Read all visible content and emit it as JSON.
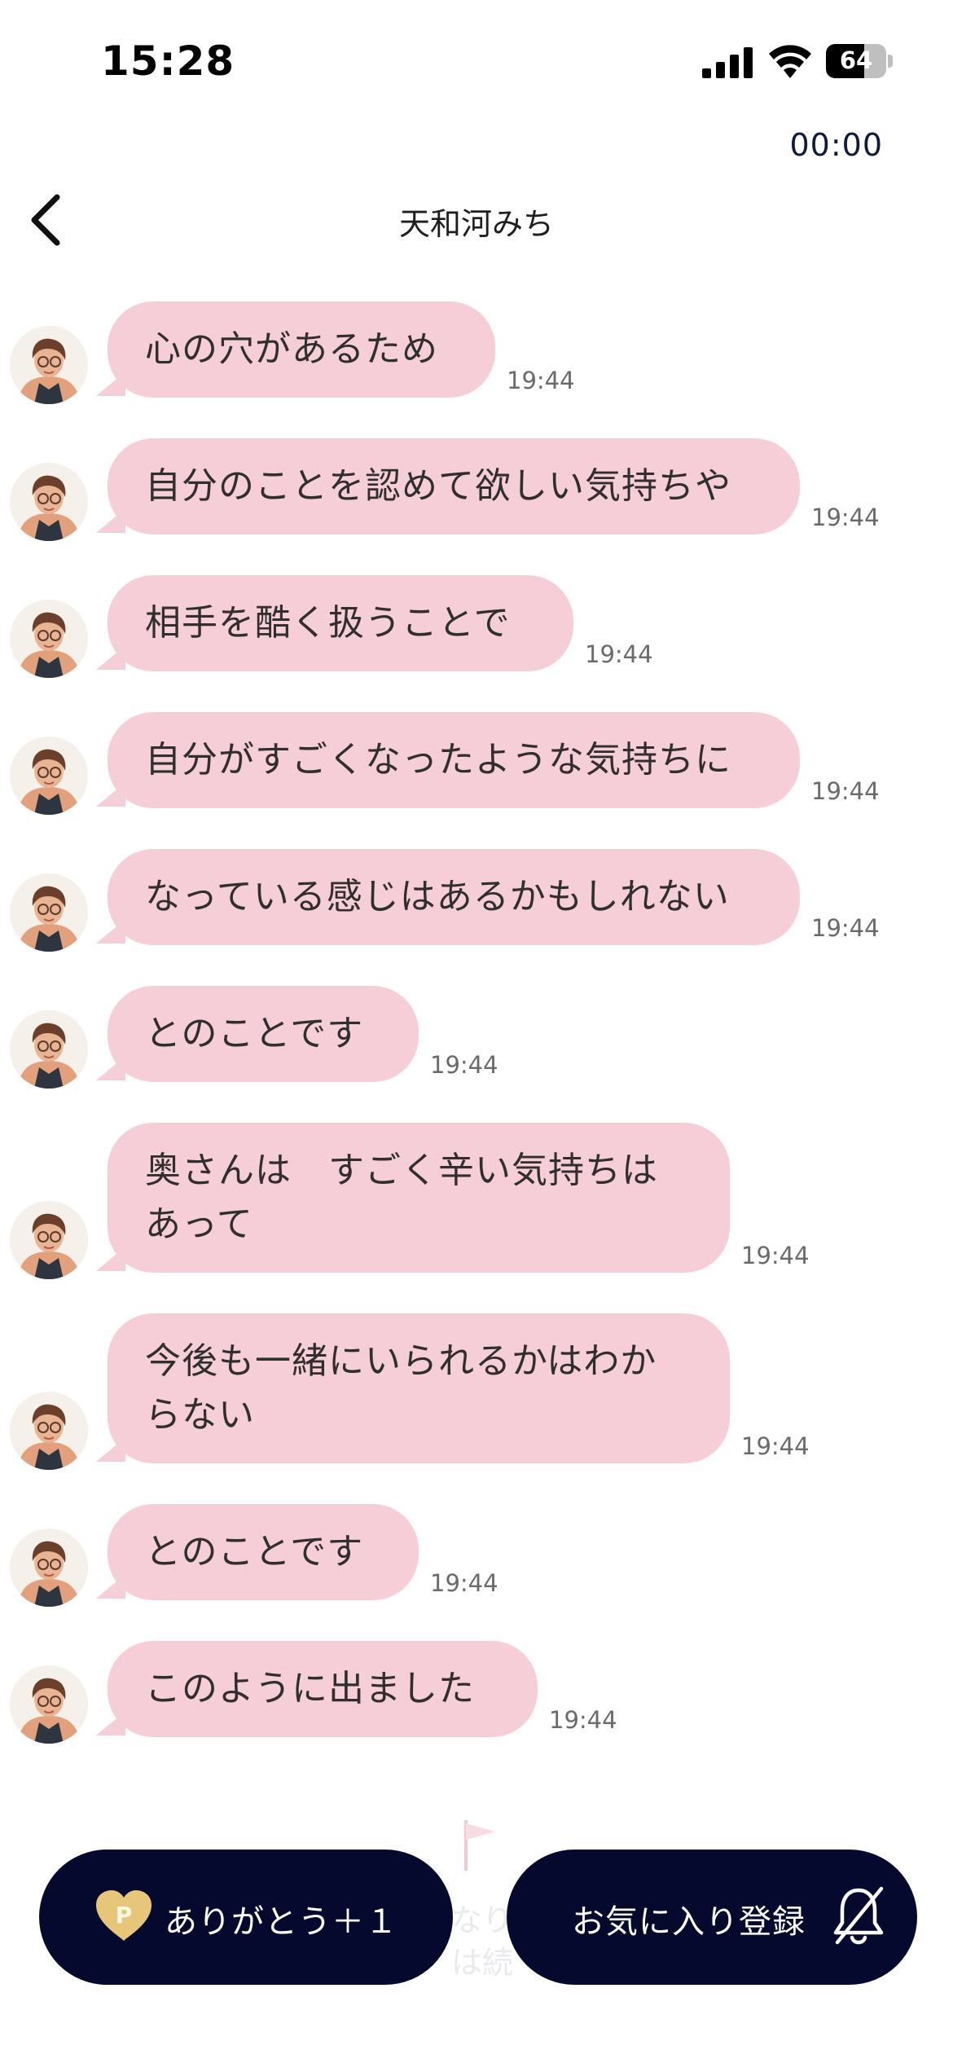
{
  "status_bar": {
    "time": "15:28",
    "battery": "64",
    "battery_level": 0.64
  },
  "timer": "00:00",
  "header": {
    "title": "天和河みち"
  },
  "messages": [
    {
      "text": "心の穴があるため",
      "time": "19:44"
    },
    {
      "text": "自分のことを認めて欲しい気持ちや",
      "time": "19:44"
    },
    {
      "text": "相手を酷く扱うことで",
      "time": "19:44"
    },
    {
      "text": "自分がすごくなったような気持ちに",
      "time": "19:44"
    },
    {
      "text": "なっている感じはあるかもしれない",
      "time": "19:44"
    },
    {
      "text": "とのことです",
      "time": "19:44"
    },
    {
      "text": "奥さんは　すごく辛い気持ちは\nあって",
      "time": "19:44"
    },
    {
      "text": "今後も一緒にいられるかはわか\nらない",
      "time": "19:44"
    },
    {
      "text": "とのことです",
      "time": "19:44"
    },
    {
      "text": "このように出ました",
      "time": "19:44"
    }
  ],
  "bottom_bar": {
    "thanks_label": "ありがとう＋１",
    "thanks_icon_letter": "P",
    "favorite_label": "お気に入り登録",
    "background_fragment_1": "なり",
    "background_fragment_2": "は続"
  },
  "colors": {
    "bubble": "#f6ced7",
    "button": "#06092e",
    "heart": "#e6c77a"
  },
  "icons": {
    "back": "chevron-left-icon",
    "favorite": "bell-off-icon",
    "thanks": "heart-points-icon"
  }
}
